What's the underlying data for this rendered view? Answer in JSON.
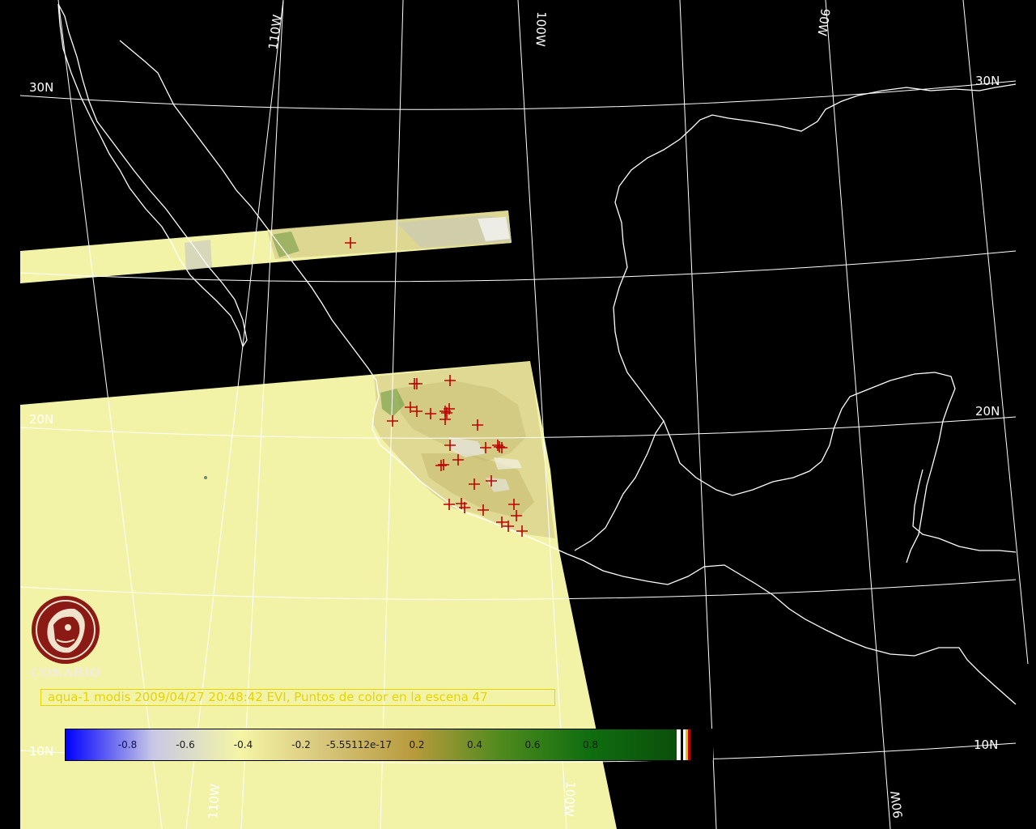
{
  "map": {
    "grid_labels": {
      "lon_top": [
        "110W",
        "100W",
        "90W"
      ],
      "lon_bottom": [
        "110W",
        "100W",
        "90W"
      ],
      "lat_left": [
        "30N",
        "20N",
        "10N"
      ],
      "lat_right": [
        "30N",
        "20N",
        "10N"
      ]
    },
    "colors": {
      "background": "#000000",
      "land_swath": "#f3f3a8",
      "coastline": "#ffffff",
      "graticule": "#ffffff",
      "fire_marker": "#c00000"
    },
    "marker_count": 47
  },
  "logo": {
    "text": "CONABIO",
    "icon": "conabio-macaw-emblem"
  },
  "caption": {
    "text": "aqua-1 modis 2009/04/27 20:48:42 EVI, Puntos de color en la escena 47"
  },
  "colorbar": {
    "title": "",
    "tick_labels": [
      "-0.8",
      "-0.6",
      "-0.4",
      "-0.2",
      "-5.55112e-17",
      "0.2",
      "0.4",
      "0.6",
      "0.8"
    ],
    "tick_values": [
      -0.8,
      -0.6,
      -0.4,
      -0.2,
      0.0,
      0.2,
      0.4,
      0.6,
      0.8
    ],
    "range": [
      -1.0,
      1.0
    ],
    "stops": [
      "#0000ff",
      "#c8c8e6",
      "#f5f5a5",
      "#d6c478",
      "#b79a3c",
      "#4e8a1e",
      "#0f6e0f",
      "#0b4f0b"
    ],
    "end_swatches": [
      "#ffffff",
      "#000000",
      "#ffffff",
      "#e0c000",
      "#c00000",
      "#000000"
    ]
  }
}
